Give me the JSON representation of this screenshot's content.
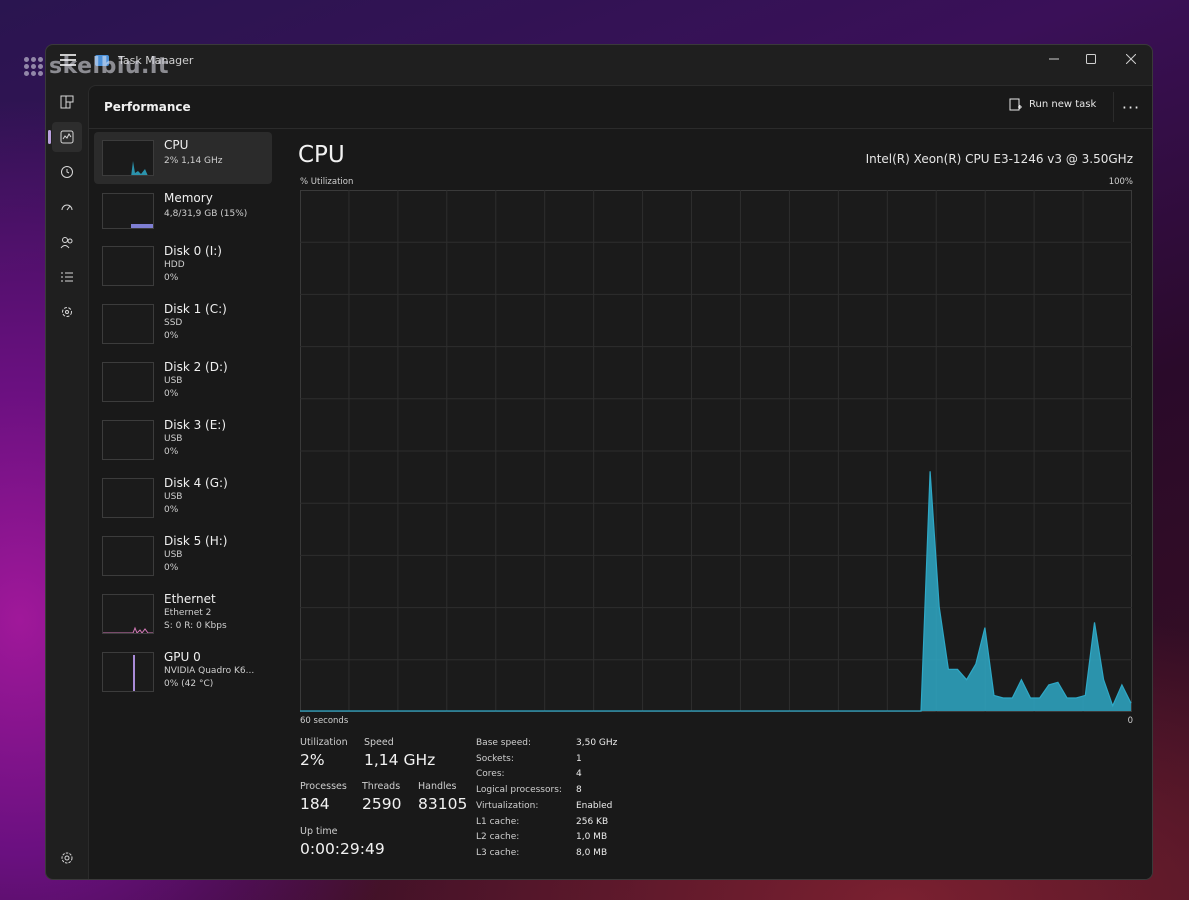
{
  "watermark": "skelbiu.lt",
  "window": {
    "title": "Task Manager"
  },
  "header": {
    "title": "Performance",
    "run_new_task": "Run new task",
    "more": "···"
  },
  "sidebar": {
    "items": [
      {
        "name": "CPU",
        "sub1": "2%  1,14 GHz",
        "sub2": ""
      },
      {
        "name": "Memory",
        "sub1": "4,8/31,9 GB (15%)",
        "sub2": ""
      },
      {
        "name": "Disk 0 (I:)",
        "sub1": "HDD",
        "sub2": "0%"
      },
      {
        "name": "Disk 1 (C:)",
        "sub1": "SSD",
        "sub2": "0%"
      },
      {
        "name": "Disk 2 (D:)",
        "sub1": "USB",
        "sub2": "0%"
      },
      {
        "name": "Disk 3 (E:)",
        "sub1": "USB",
        "sub2": "0%"
      },
      {
        "name": "Disk 4 (G:)",
        "sub1": "USB",
        "sub2": "0%"
      },
      {
        "name": "Disk 5 (H:)",
        "sub1": "USB",
        "sub2": "0%"
      },
      {
        "name": "Ethernet",
        "sub1": "Ethernet 2",
        "sub2": "S: 0 R: 0 Kbps"
      },
      {
        "name": "GPU 0",
        "sub1": "NVIDIA Quadro K6...",
        "sub2": "0%  (42 °C)"
      }
    ]
  },
  "main": {
    "title": "CPU",
    "cpu_name": "Intel(R) Xeon(R) CPU E3-1246 v3 @ 3.50GHz",
    "util_label": "% Utilization",
    "max_label": "100%",
    "time_label": "60 seconds",
    "zero_label": "0"
  },
  "stats": {
    "utilization_label": "Utilization",
    "utilization": "2%",
    "speed_label": "Speed",
    "speed": "1,14 GHz",
    "processes_label": "Processes",
    "processes": "184",
    "threads_label": "Threads",
    "threads": "2590",
    "handles_label": "Handles",
    "handles": "83105",
    "uptime_label": "Up time",
    "uptime": "0:00:29:49"
  },
  "details": [
    {
      "k": "Base speed:",
      "v": "3,50 GHz"
    },
    {
      "k": "Sockets:",
      "v": "1"
    },
    {
      "k": "Cores:",
      "v": "4"
    },
    {
      "k": "Logical processors:",
      "v": "8"
    },
    {
      "k": "Virtualization:",
      "v": "Enabled"
    },
    {
      "k": "L1 cache:",
      "v": "256 KB"
    },
    {
      "k": "L2 cache:",
      "v": "1,0 MB"
    },
    {
      "k": "L3 cache:",
      "v": "8,0 MB"
    }
  ],
  "chart_data": {
    "type": "area",
    "x_range_seconds": [
      60,
      0
    ],
    "ylim": [
      0,
      100
    ],
    "samples": [
      0,
      0,
      0,
      0,
      0,
      0,
      0,
      0,
      0,
      0,
      0,
      0,
      0,
      0,
      0,
      0,
      0,
      0,
      0,
      0,
      0,
      0,
      0,
      0,
      0,
      0,
      0,
      0,
      0,
      0,
      0,
      0,
      0,
      0,
      0,
      0,
      0,
      0,
      0,
      0,
      0,
      0,
      0,
      0,
      0,
      0,
      0,
      0,
      0,
      0,
      0,
      0,
      0,
      0,
      0,
      0,
      0,
      0,
      0,
      0,
      0,
      0,
      0,
      0,
      0,
      0,
      0,
      0,
      0,
      46,
      20,
      8,
      8,
      6,
      9,
      16,
      3,
      2.5,
      2.5,
      6,
      2.5,
      2.5,
      5,
      5.5,
      2.5,
      2.5,
      3,
      17,
      6,
      1,
      5,
      1.5
    ],
    "color": "#2ea8c6"
  },
  "colors": {
    "accent": "#bba0e0",
    "cpu_line": "#2ea8c6",
    "memory": "#8b8be8",
    "ethernet": "#d47ab8",
    "gpu": "#a98bd8"
  }
}
